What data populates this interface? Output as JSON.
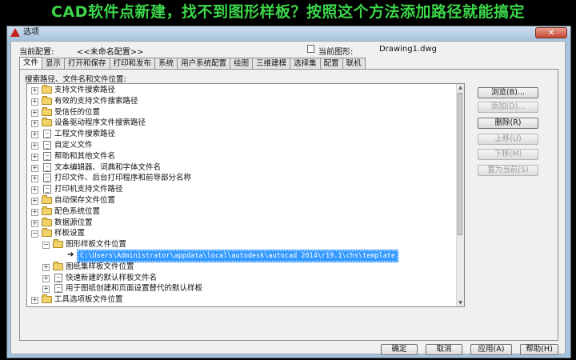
{
  "banner": "CAD软件点新建，找不到图形样板？按照这个方法添加路径就能搞定",
  "window": {
    "title": "选项",
    "close_label": "✕"
  },
  "profile": {
    "label": "当前配置:",
    "value": "<<未命名配置>>"
  },
  "drawing": {
    "label": "当前图形:",
    "value": "Drawing1.dwg"
  },
  "tabs": [
    "文件",
    "显示",
    "打开和保存",
    "打印和发布",
    "系统",
    "用户系统配置",
    "绘图",
    "三维建模",
    "选择集",
    "配置",
    "联机"
  ],
  "panel_label": "搜索路径、文件名和文件位置:",
  "tree": [
    {
      "label": "支持文件搜索路径",
      "expander": "+"
    },
    {
      "label": "有效的支持文件搜索路径",
      "expander": "+"
    },
    {
      "label": "受信任的位置",
      "expander": "+"
    },
    {
      "label": "设备驱动程序文件搜索路径",
      "expander": "+"
    },
    {
      "label": "工程文件搜索路径",
      "expander": "+"
    },
    {
      "label": "自定义文件",
      "expander": "+"
    },
    {
      "label": "帮助和其他文件名",
      "expander": "+"
    },
    {
      "label": "文本编辑器、词典和字体文件名",
      "expander": "+"
    },
    {
      "label": "打印文件、后台打印程序和前导部分名称",
      "expander": "+"
    },
    {
      "label": "打印机支持文件路径",
      "expander": "+"
    },
    {
      "label": "自动保存文件位置",
      "expander": "+"
    },
    {
      "label": "配色系统位置",
      "expander": "+"
    },
    {
      "label": "数据源位置",
      "expander": "+"
    },
    {
      "label": "样板设置",
      "expander": "−"
    },
    {
      "label": "图形样板文件位置",
      "expander": "−"
    },
    {
      "path": "C:\\Users\\Administrator\\appdata\\local\\autodesk\\autocad 2014\\r19.1\\chs\\template"
    },
    {
      "label": "图纸集样板文件位置",
      "expander": "+"
    },
    {
      "label": "快速新建的默认样板文件名",
      "expander": "+"
    },
    {
      "label": "用于图纸创建和页面设置替代的默认样板",
      "expander": "+"
    },
    {
      "label": "工具选项板文件位置",
      "expander": "+"
    }
  ],
  "buttons": {
    "browse": "浏览(B)...",
    "add": "添加(D)...",
    "remove": "删除(R)",
    "move_up": "上移(U)",
    "move_down": "下移(M)",
    "set_current": "置为当前(S)"
  },
  "footer": {
    "ok": "确定",
    "cancel": "取消",
    "apply": "应用(A)",
    "help": "帮助(H)"
  },
  "colors": {
    "banner": "#3cd64a",
    "selection": "#3399ff",
    "folder": "#f2d36a"
  },
  "icons": {
    "folder": "folder-icon",
    "document": "document-icon",
    "pointer": "arrow-pointer-icon"
  }
}
